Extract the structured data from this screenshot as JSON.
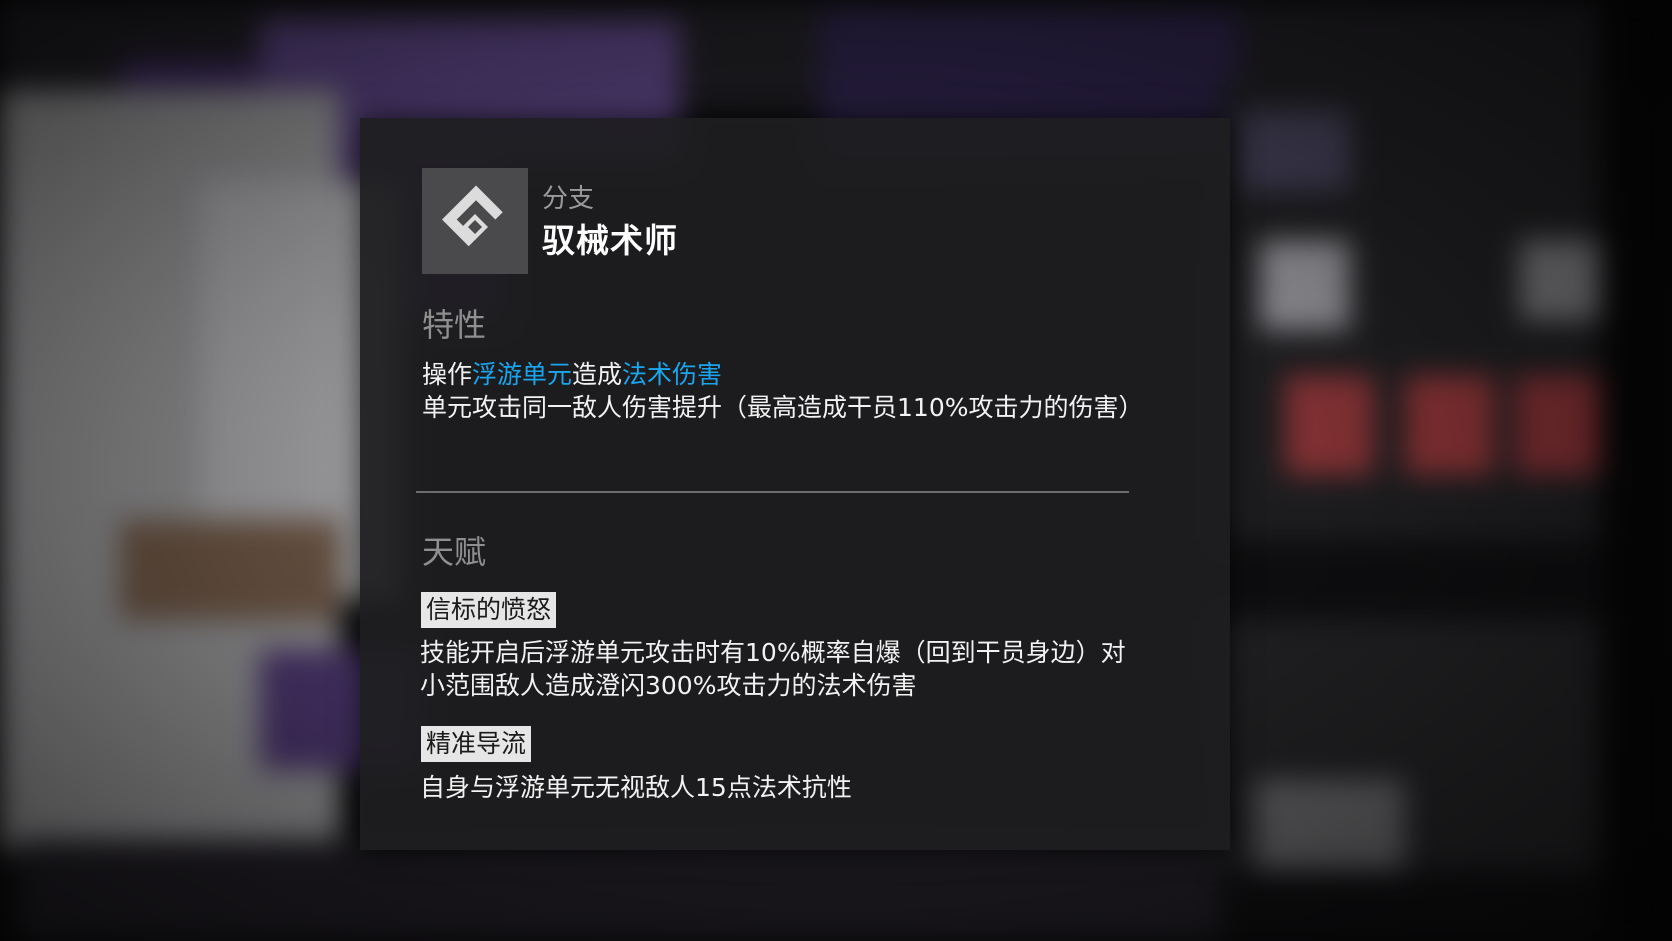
{
  "branch": {
    "caption": "分支",
    "name": "驭械术师",
    "icon": "mechanic-branch-icon"
  },
  "trait": {
    "title": "特性",
    "line1_prefix": "操作",
    "line1_hl1": "浮游单元",
    "line1_mid": "造成",
    "line1_hl2": "法术伤害",
    "line2": "单元攻击同一敌人伤害提升（最高造成干员110%攻击力的伤害）"
  },
  "talents": {
    "title": "天赋",
    "items": [
      {
        "name": "信标的愤怒",
        "desc": "技能开启后浮游单元攻击时有10%概率自爆（回到干员身边）对小范围敌人造成澄闪300%攻击力的法术伤害"
      },
      {
        "name": "精准导流",
        "desc": "自身与浮游单元无视敌人15点法术抗性"
      }
    ]
  },
  "colors": {
    "highlight": "#1aa6ee",
    "panel_bg": "#1e1e20",
    "icon_box": "#4a4a4c"
  }
}
